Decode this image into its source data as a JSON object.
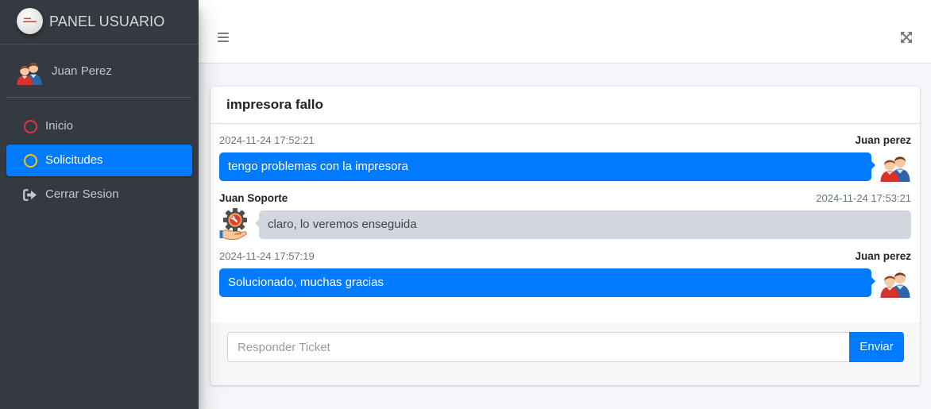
{
  "brand": {
    "title": "PANEL USUARIO",
    "logo_icon": "company-logo-icon"
  },
  "user": {
    "name": "Juan Perez",
    "avatar": "users-avatar-icon"
  },
  "nav": [
    {
      "label": "Inicio",
      "icon": "circle-outline-icon",
      "icon_color": "#dc3545",
      "active": false
    },
    {
      "label": "Solicitudes",
      "icon": "circle-outline-icon",
      "icon_color": "#ffc107",
      "active": true
    },
    {
      "label": "Cerrar Sesion",
      "icon": "sign-out-icon",
      "icon_color": "#c2c7d0",
      "active": false
    }
  ],
  "navbar": {
    "menu_icon": "hamburger-menu-icon",
    "fullscreen_icon": "expand-arrows-icon"
  },
  "ticket": {
    "title": "impresora fallo",
    "messages": [
      {
        "author": "Juan perez",
        "timestamp": "2024-11-24 17:52:21",
        "text": "tengo problemas con la impresora",
        "avatar": "users-avatar-icon"
      },
      {
        "author": "Juan Soporte",
        "timestamp": "2024-11-24 17:53:21",
        "text": "claro, lo veremos enseguida",
        "avatar": "support-gear-avatar-icon"
      },
      {
        "author": "Juan perez",
        "timestamp": "2024-11-24 17:57:19",
        "text": "Solucionado, muchas gracias",
        "avatar": "users-avatar-icon"
      }
    ],
    "reply": {
      "placeholder": "Responder Ticket",
      "value": "",
      "send_label": "Enviar"
    }
  },
  "colors": {
    "primary": "#007bff",
    "sidebar_bg": "#343a40",
    "content_bg": "#f4f6f9",
    "bubble_other": "#d2d6de"
  }
}
